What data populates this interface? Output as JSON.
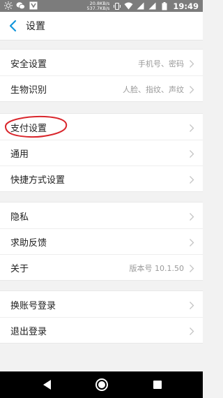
{
  "status_bar": {
    "speed_up": "20.8KB/s",
    "speed_down": "537.7KB/s",
    "time": "19:49",
    "icons": [
      "brightness-icon",
      "wechat-icon",
      "app-icon",
      "vibrate-icon",
      "wifi-icon",
      "signal-icon",
      "signal-icon",
      "battery-icon"
    ]
  },
  "header": {
    "title": "设置"
  },
  "groups": [
    [
      {
        "label": "安全设置",
        "value": "手机号、密码"
      },
      {
        "label": "生物识别",
        "value": "人脸、指纹、声纹"
      }
    ],
    [
      {
        "label": "支付设置",
        "value": ""
      },
      {
        "label": "通用",
        "value": ""
      },
      {
        "label": "快捷方式设置",
        "value": ""
      }
    ],
    [
      {
        "label": "隐私",
        "value": ""
      },
      {
        "label": "求助反馈",
        "value": ""
      },
      {
        "label": "关于",
        "value": "版本号 10.1.50"
      }
    ],
    [
      {
        "label": "换账号登录",
        "value": ""
      },
      {
        "label": "退出登录",
        "value": ""
      }
    ]
  ],
  "colors": {
    "accent": "#1296db",
    "annotation": "#d9262c"
  }
}
